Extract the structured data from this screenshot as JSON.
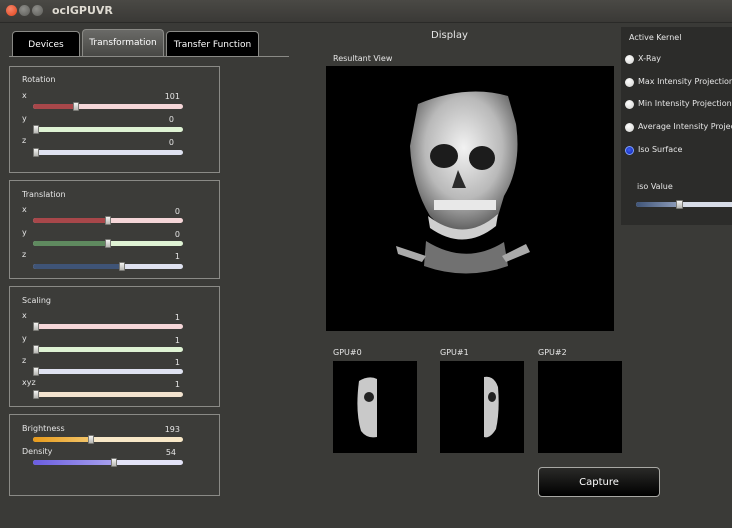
{
  "window": {
    "title": "oclGPUVR"
  },
  "tabs": [
    {
      "label": "Devices",
      "active": false
    },
    {
      "label": "Transformation",
      "active": true
    },
    {
      "label": "Transfer Function",
      "active": false
    }
  ],
  "rotation": {
    "title": "Rotation",
    "sliders": [
      {
        "label": "x",
        "value": "101",
        "fraction": 0.28
      },
      {
        "label": "y",
        "value": "0",
        "fraction": 0.0
      },
      {
        "label": "z",
        "value": "0",
        "fraction": 0.0
      }
    ]
  },
  "translation": {
    "title": "Translation",
    "sliders": [
      {
        "label": "x",
        "value": "0",
        "fraction": 0.5
      },
      {
        "label": "y",
        "value": "0",
        "fraction": 0.5
      },
      {
        "label": "z",
        "value": "1",
        "fraction": 0.6
      }
    ]
  },
  "scaling": {
    "title": "Scaling",
    "sliders": [
      {
        "label": "x",
        "value": "1",
        "fraction": 0.0
      },
      {
        "label": "y",
        "value": "1",
        "fraction": 0.0
      },
      {
        "label": "z",
        "value": "1",
        "fraction": 0.0
      },
      {
        "label": "xyz",
        "value": "1",
        "fraction": 0.0
      }
    ]
  },
  "appearance": {
    "sliders": [
      {
        "label": "Brightness",
        "value": "193",
        "fraction": 0.38
      },
      {
        "label": "Density",
        "value": "54",
        "fraction": 0.54
      }
    ]
  },
  "display": {
    "title": "Display",
    "resultant_label": "Resultant View",
    "gpus": [
      "GPU#0",
      "GPU#1",
      "GPU#2"
    ],
    "capture_label": "Capture"
  },
  "kernel": {
    "title": "Active Kernel",
    "options": [
      {
        "label": "X-Ray",
        "selected": false
      },
      {
        "label": "Max Intensity Projection",
        "selected": false
      },
      {
        "label": "Min Intensity Projection",
        "selected": false
      },
      {
        "label": "Average Intensity Projectio",
        "selected": false
      },
      {
        "label": "Iso Surface",
        "selected": true
      }
    ],
    "iso_label": "iso Value",
    "iso_fraction": 0.38
  },
  "colors": {
    "window_bg": "#3a3a37",
    "red_fill": "#a8474a",
    "green_fill": "#5f8a5f",
    "blue_fill": "#3f5477",
    "selected_radio": "#1a3ad6"
  }
}
